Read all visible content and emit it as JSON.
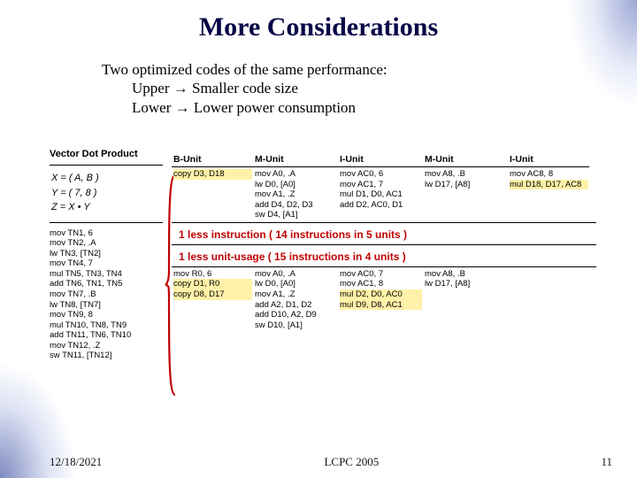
{
  "title": "More Considerations",
  "intro_line": "Two optimized codes of the same performance:",
  "intro_sub1": "Upper → Smaller code size",
  "intro_sub2": "Lower → Lower power consumption",
  "footer": {
    "date": "12/18/2021",
    "venue": "LCPC 2005",
    "page": "11"
  },
  "vdp": {
    "title": "Vector Dot Product",
    "math_x": "X = ( A, B )",
    "math_y": "Y = ( 7, 8 )",
    "math_z": "Z = X • Y",
    "code": "mov TN1, 6\nmov TN2, .A\nlw TN3, [TN2]\nmov TN4, 7\nmul TN5, TN3, TN4\nadd TN6, TN1, TN5\nmov TN7, .B\nlw TN8, [TN7]\nmov TN9, 8\nmul TN10, TN8, TN9\nadd TN11, TN6, TN10\nmov TN12, .Z\nsw TN11, [TN12]"
  },
  "heads": [
    "B-Unit",
    "M-Unit",
    "I-Unit",
    "M-Unit",
    "I-Unit"
  ],
  "upper": {
    "b": [
      "",
      "",
      "copy D3, D18"
    ],
    "m1": [
      "mov A0, .A",
      "lw D0, [A0]",
      "",
      "mov A1, .Z",
      "add D4, D2, D3",
      "sw D4, [A1]"
    ],
    "i1": [
      "mov AC0, 6",
      "mov AC1, 7",
      "mul D1, D0, AC1",
      "add D2, AC0, D1"
    ],
    "m2": [
      "mov A8, .B",
      "lw D17, [A8]"
    ],
    "i2": [
      "mov AC8, 8",
      "",
      "mul D18, D17, AC8"
    ]
  },
  "banner1": "1 less instruction ( 14 instructions in 5 units )",
  "banner2": "1 less unit-usage ( 15 instructions in 4 units )",
  "lower": {
    "b": [
      "mov R0, 6",
      "copy D1, R0",
      "copy D8, D17"
    ],
    "m1": [
      "mov A0, .A",
      "lw D0, [A0]",
      "mov A1, .Z",
      "add A2, D1, D2",
      "add D10, A2, D9",
      "sw D10, [A1]"
    ],
    "i1": [
      "mov AC0, 7",
      "mov AC1, 8",
      "mul D2, D0, AC0",
      "mul D9, D8, AC1"
    ],
    "m2": [
      "mov A8, .B",
      "lw D17, [A8]"
    ]
  }
}
